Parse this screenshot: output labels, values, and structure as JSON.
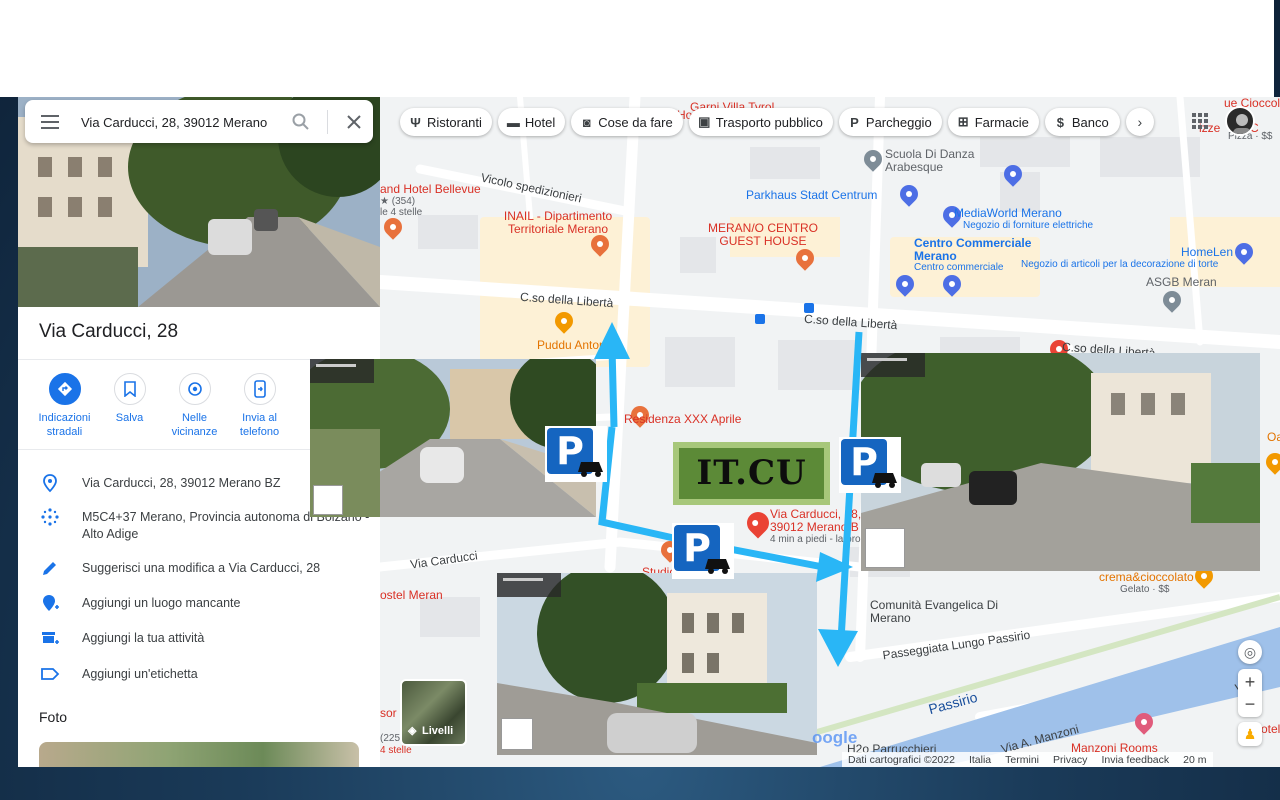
{
  "search": {
    "value": "Via Carducci, 28, 39012 Merano"
  },
  "place": {
    "title": "Via Carducci, 28",
    "actions": [
      {
        "label": "Indicazioni stradali",
        "icon": "directions-icon"
      },
      {
        "label": "Salva",
        "icon": "bookmark-icon"
      },
      {
        "label": "Nelle vicinanze",
        "icon": "nearby-icon"
      },
      {
        "label": "Invia al telefono",
        "icon": "send-to-phone-icon"
      }
    ],
    "info": [
      {
        "text": "Via Carducci, 28, 39012 Merano BZ",
        "icon": "location-pin-icon"
      },
      {
        "text": "M5C4+37 Merano, Provincia autonoma di Bolzano - Alto Adige",
        "icon": "plus-code-icon"
      },
      {
        "text": "Suggerisci una modifica a Via Carducci, 28",
        "icon": "edit-pencil-icon"
      },
      {
        "text": "Aggiungi un luogo mancante",
        "icon": "add-place-icon"
      },
      {
        "text": "Aggiungi la tua attività",
        "icon": "add-business-icon"
      },
      {
        "text": "Aggiungi un'etichetta",
        "icon": "label-tag-icon"
      }
    ],
    "photos_heading": "Foto"
  },
  "chips": [
    {
      "label": "Ristoranti",
      "icon": "restaurant-icon"
    },
    {
      "label": "Hotel",
      "icon": "hotel-icon"
    },
    {
      "label": "Cose da fare",
      "icon": "camera-icon"
    },
    {
      "label": "Trasporto pubblico",
      "icon": "transit-icon"
    },
    {
      "label": "Parcheggio",
      "icon": "parking-icon"
    },
    {
      "label": "Farmacie",
      "icon": "pharmacy-icon"
    },
    {
      "label": "Banco",
      "icon": "atm-icon"
    }
  ],
  "map": {
    "places": {
      "garni": "Garni Villa Tyrol",
      "ho": "Ho",
      "hotel_bellevue": "and Hotel Bellevue",
      "bellevue_rating": "★ (354)",
      "bellevue_stars": "le 4 stelle",
      "inail": "INAIL - Dipartimento Territoriale Merano",
      "merano_centro": "MERAN/O CENTRO GUEST HOUSE",
      "scuola_danza": "Scuola Di Danza Arabesque",
      "parkhaus": "Parkhaus Stadt Centrum",
      "mediaworld": "MediaWorld Merano",
      "mediaworld_sub": "Negozio di forniture elettriche",
      "centro_commerciale": "Centro Commerciale Merano",
      "centro_commerciale_sub": "Centro commerciale",
      "homelen": "HomeLen",
      "homelen_sub": "Negozio di articoli per la decorazione di torte",
      "asgb": "ASGB Meran",
      "pizze": "izze",
      "bc": "BC",
      "cioccolate": "ue Cioccolate",
      "pizza_price": "Pizza · $$",
      "puddu": "Puddu Antoni",
      "residenza": "Residenza XXX Aprile",
      "target_line1": "Via Carducci, 28,",
      "target_line2": "39012 Merano B",
      "target_walk": "4 min a piedi - la pro",
      "studio": "Studio",
      "ostel": "ostel Meran",
      "comunita": "Comunità Evangelica Di Merano",
      "crema": "crema&cioccolato",
      "crema_sub": "Gelato · $$",
      "oas": "Oas",
      "passiro": "Passirio",
      "h2o": "H2o Parrucchieri",
      "manzoni_rooms": "Manzoni Rooms",
      "otel": "otel",
      "hotel_left_a": "sor",
      "hotel_left_b": "(225",
      "hotel_left_c": "4 stelle"
    },
    "roads": {
      "vicolo": "Vicolo spedizionieri",
      "corso1": "C.so della Libertà",
      "corso2": "C.so della Libertà",
      "corso3": "C.so della Libertà",
      "via_carducci": "Via Carducci",
      "lungo_passirio": "Passeggiata Lungo Passirio",
      "via_manzoni": "Via A. Manzoni",
      "via_right": "Via"
    },
    "overlay_text": "IT.CU",
    "livelli_label": "Livelli",
    "attribution": [
      "Dati cartografici ©2022",
      "Italia",
      "Termini",
      "Privacy",
      "Invia feedback",
      "20 m"
    ],
    "google_logo": "oogle"
  },
  "colors": {
    "accent": "#1a73e8",
    "route": "#29b6f6",
    "parking": "#1565c0",
    "place_red": "#d93025"
  }
}
